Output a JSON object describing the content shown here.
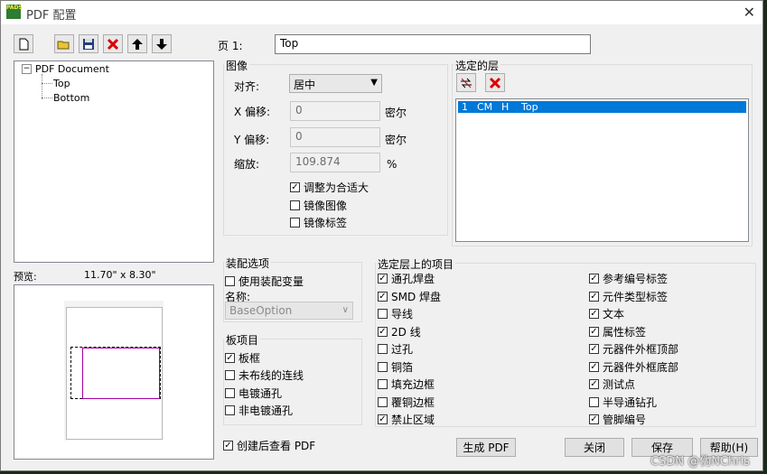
{
  "window": {
    "title": "PDF 配置",
    "app_icon": "PADS"
  },
  "toolbar": {
    "icons": [
      "new-page-icon",
      "open-folder-icon",
      "save-icon",
      "delete-icon",
      "move-up-icon",
      "move-down-icon"
    ]
  },
  "page": {
    "label": "页 1:",
    "value": "Top"
  },
  "tree": {
    "root": "PDF Document",
    "children": [
      "Top",
      "Bottom"
    ]
  },
  "preview": {
    "label": "预览:",
    "size": "11.70\" x  8.30\""
  },
  "image": {
    "group_label": "图像",
    "align_label": "对齐:",
    "align_value": "居中",
    "x_label": "X 偏移:",
    "x_value": "0",
    "x_unit": "密尔",
    "y_label": "Y 偏移:",
    "y_value": "0",
    "y_unit": "密尔",
    "scale_label": "缩放:",
    "scale_value": "109.874",
    "scale_unit": "%",
    "options": [
      {
        "label": "调整为合适大",
        "checked": true
      },
      {
        "label": "镜像图像",
        "checked": false
      },
      {
        "label": "镜像标签",
        "checked": false
      }
    ]
  },
  "selected_layers": {
    "group_label": "选定的层",
    "rows": [
      {
        "num": "1",
        "c1": "CM",
        "c2": "H",
        "name": "Top"
      }
    ]
  },
  "assembly": {
    "group_label": "装配选项",
    "use_variant": "使用装配变量",
    "name_label": "名称:",
    "name_value": "BaseOption"
  },
  "board": {
    "group_label": "板项目",
    "items": [
      {
        "label": "板框",
        "checked": true
      },
      {
        "label": "未布线的连线",
        "checked": false
      },
      {
        "label": "电镀通孔",
        "checked": false
      },
      {
        "label": "非电镀通孔",
        "checked": false
      }
    ]
  },
  "layer_items": {
    "group_label": "选定层上的项目",
    "left": [
      {
        "label": "通孔焊盘",
        "checked": true
      },
      {
        "label": "SMD 焊盘",
        "checked": true
      },
      {
        "label": "导线",
        "checked": false
      },
      {
        "label": "2D 线",
        "checked": true
      },
      {
        "label": "过孔",
        "checked": false
      },
      {
        "label": "铜箔",
        "checked": false
      },
      {
        "label": "填充边框",
        "checked": false
      },
      {
        "label": "覆铜边框",
        "checked": false
      },
      {
        "label": "禁止区域",
        "checked": true
      }
    ],
    "right": [
      {
        "label": "参考编号标签",
        "checked": true
      },
      {
        "label": "元件类型标签",
        "checked": true
      },
      {
        "label": "文本",
        "checked": true
      },
      {
        "label": "属性标签",
        "checked": true
      },
      {
        "label": "元器件外框顶部",
        "checked": true
      },
      {
        "label": "元器件外框底部",
        "checked": true
      },
      {
        "label": "测试点",
        "checked": true
      },
      {
        "label": "半导通钻孔",
        "checked": false
      },
      {
        "label": "管脚编号",
        "checked": true
      }
    ]
  },
  "footer": {
    "view_after": "创建后查看 PDF",
    "view_after_checked": true,
    "generate": "生成 PDF",
    "close": "关闭",
    "save": "保存",
    "help": "帮助(H)"
  },
  "watermark": "CSDN @伪NChris"
}
